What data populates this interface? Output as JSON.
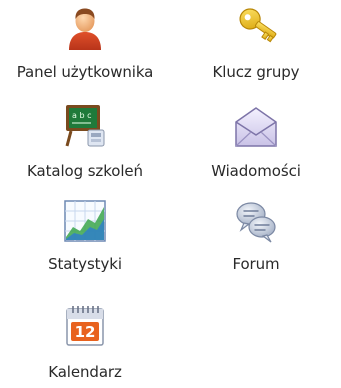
{
  "menu": {
    "items": [
      {
        "label": "Panel użytkownika",
        "icon": "user-icon"
      },
      {
        "label": "Klucz grupy",
        "icon": "key-icon"
      },
      {
        "label": "Katalog szkoleń",
        "icon": "chalkboard-icon"
      },
      {
        "label": "Wiadomości",
        "icon": "envelope-icon"
      },
      {
        "label": "Statystyki",
        "icon": "chart-icon"
      },
      {
        "label": "Forum",
        "icon": "chat-bubbles-icon"
      },
      {
        "label": "Kalendarz",
        "icon": "calendar-icon"
      }
    ],
    "calendar_day": "12"
  }
}
